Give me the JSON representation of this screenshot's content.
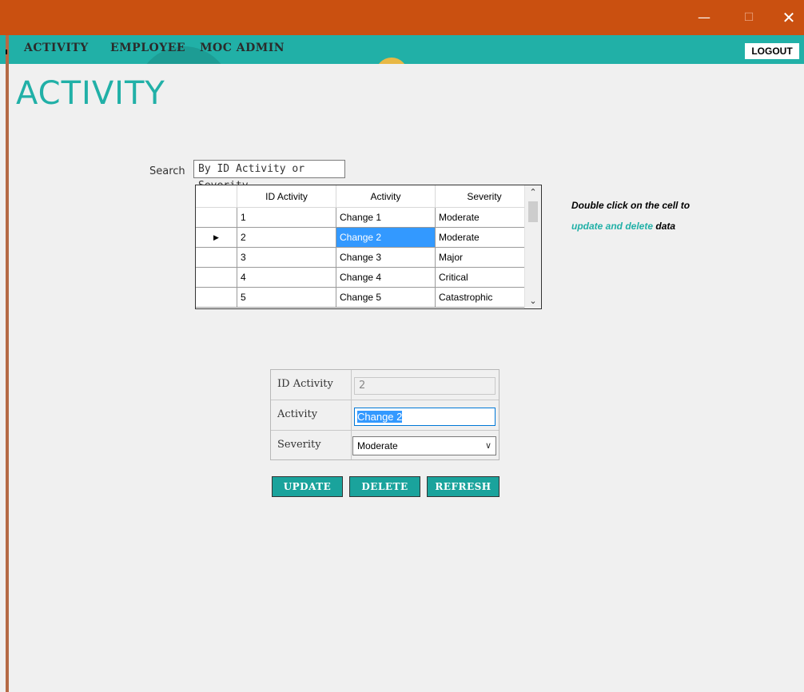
{
  "window": {
    "minimize_glyph": "—",
    "maximize_glyph": "☐",
    "close_glyph": "✕"
  },
  "menu": {
    "items": [
      "ACTIVITY",
      "EMPLOYEE",
      "MOC ADMIN"
    ],
    "logout_label": "LOGOUT"
  },
  "page": {
    "title": "ACTIVITY"
  },
  "search": {
    "label": "Search",
    "value": "By ID Activity or Severity"
  },
  "grid": {
    "columns": [
      "ID Activity",
      "Activity",
      "Severity"
    ],
    "rows": [
      [
        "1",
        "Change 1",
        "Moderate"
      ],
      [
        "2",
        "Change 2",
        "Moderate"
      ],
      [
        "3",
        "Change 3",
        "Major"
      ],
      [
        "4",
        "Change 4",
        "Critical"
      ],
      [
        "5",
        "Change 5",
        "Catastrophic"
      ]
    ],
    "current_row_marker": "▶"
  },
  "hint": {
    "line1": "Double click on the cell to",
    "line2_highlight": "update and delete",
    "line2_rest": " data"
  },
  "form": {
    "id_label": "ID Activity",
    "id_value": "2",
    "activity_label": "Activity",
    "activity_value": "Change 2",
    "severity_label": "Severity",
    "severity_value": "Moderate"
  },
  "buttons": {
    "update": "UPDATE",
    "delete": "DELETE",
    "refresh": "REFRESH"
  },
  "colors": {
    "titlebar": "#ca5010",
    "accent": "#21b0a7",
    "selection": "#3399ff"
  },
  "icons": [
    "minimize-icon",
    "maximize-icon",
    "close-icon",
    "row-pointer-icon",
    "chevron-down-icon",
    "scroll-up-icon",
    "scroll-down-icon"
  ]
}
